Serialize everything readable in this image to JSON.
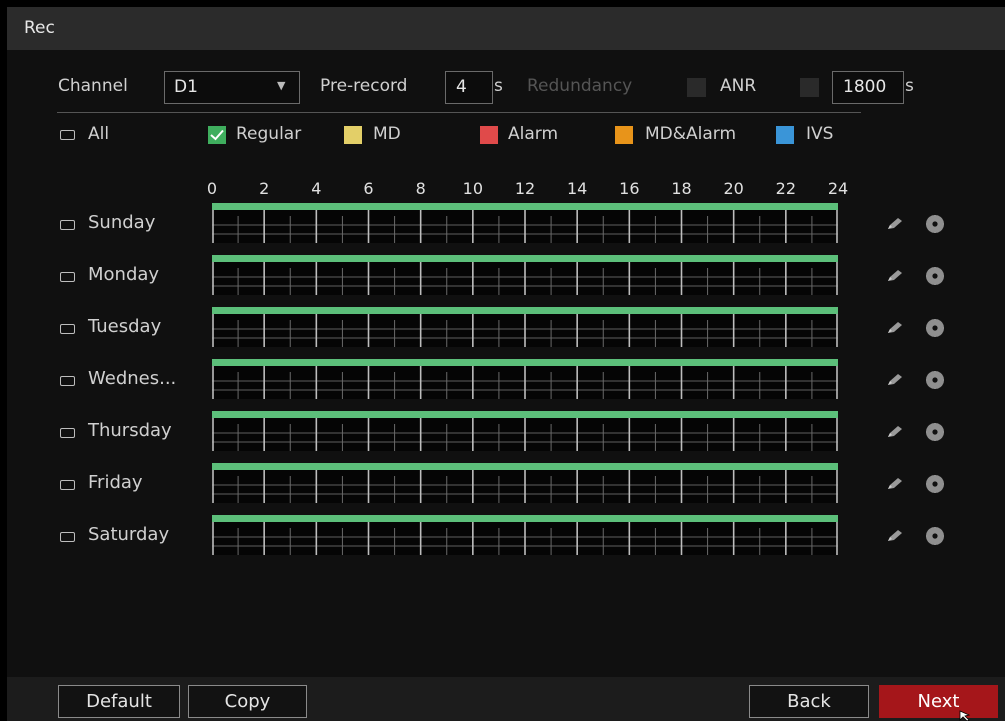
{
  "window": {
    "title": "Rec"
  },
  "settings": {
    "channel_label": "Channel",
    "channel_value": "D1",
    "prerecord_label": "Pre-record",
    "prerecord_value": "4",
    "prerecord_unit": "s",
    "redundancy_label": "Redundancy",
    "anr_label": "ANR",
    "anr_value": "1800",
    "anr_unit": "s"
  },
  "legend": {
    "all_label": "All",
    "items": [
      {
        "label": "Regular",
        "color": "#3fae5e",
        "checked": true
      },
      {
        "label": "MD",
        "color": "#e3cf68"
      },
      {
        "label": "Alarm",
        "color": "#e04a4a"
      },
      {
        "label": "MD&Alarm",
        "color": "#e8941a"
      },
      {
        "label": "IVS",
        "color": "#3a95d8"
      }
    ]
  },
  "timeline": {
    "hours": [
      "0",
      "2",
      "4",
      "6",
      "8",
      "10",
      "12",
      "14",
      "16",
      "18",
      "20",
      "22",
      "24"
    ],
    "record_color": "#5cbf7a"
  },
  "days": [
    {
      "label": "Sunday"
    },
    {
      "label": "Monday"
    },
    {
      "label": "Tuesday"
    },
    {
      "label": "Wednes..."
    },
    {
      "label": "Thursday"
    },
    {
      "label": "Friday"
    },
    {
      "label": "Saturday"
    }
  ],
  "buttons": {
    "default": "Default",
    "copy": "Copy",
    "back": "Back",
    "next": "Next"
  }
}
